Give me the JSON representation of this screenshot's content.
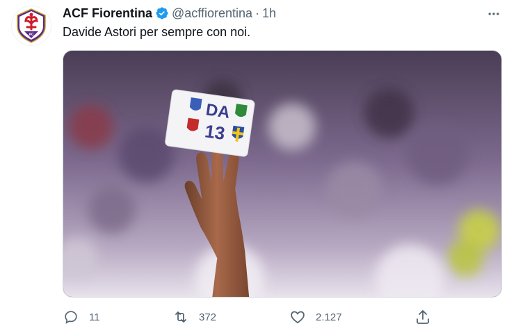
{
  "tweet": {
    "display_name": "ACF Fiorentina",
    "handle": "@acffiorentina",
    "separator": "·",
    "time": "1h",
    "text": "Davide Astori per sempre con noi.",
    "avatar_icon": "fiorentina-crest-icon",
    "verified_icon": "verified-badge-icon",
    "more_icon": "more-options-icon",
    "media": {
      "armband_text_line1": "DA",
      "armband_text_line2": "13"
    },
    "actions": {
      "reply_count": "11",
      "retweet_count": "372",
      "like_count": "2.127"
    }
  },
  "colors": {
    "text": "#0f1419",
    "secondary": "#536471",
    "verified": "#1d9bf0",
    "border": "#cfd9de",
    "crest_purple": "#5b2a86",
    "crest_red": "#d11a2a"
  }
}
